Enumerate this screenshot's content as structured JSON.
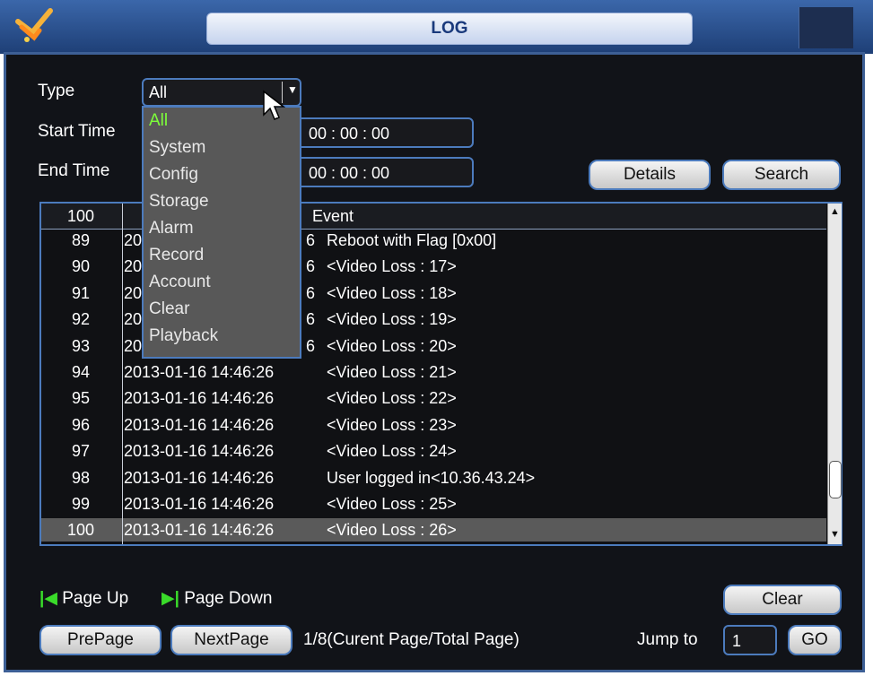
{
  "window": {
    "title": "LOG"
  },
  "filters": {
    "type_label": "Type",
    "type_value": "All",
    "start_label": "Start Time",
    "start_time": "00 :  00 :  00",
    "end_label": "End Time",
    "end_time": "00 :  00 :  00"
  },
  "buttons": {
    "details": "Details",
    "search": "Search",
    "clear": "Clear",
    "prev": "PrePage",
    "next": "NextPage",
    "go": "GO"
  },
  "dropdown_options": [
    "All",
    "System",
    "Config",
    "Storage",
    "Alarm",
    "Record",
    "Account",
    "Clear",
    "Playback"
  ],
  "table": {
    "headers": {
      "no": "100",
      "event": "Event"
    },
    "rows": [
      {
        "no": "89",
        "time": "20",
        "time_tail": "6",
        "event": "Reboot with Flag [0x00]"
      },
      {
        "no": "90",
        "time": "20",
        "time_tail": "6",
        "event": "<Video Loss : 17>"
      },
      {
        "no": "91",
        "time": "20",
        "time_tail": "6",
        "event": "<Video Loss : 18>"
      },
      {
        "no": "92",
        "time": "20",
        "time_tail": "6",
        "event": "<Video Loss : 19>"
      },
      {
        "no": "93",
        "time": "20",
        "time_tail": "6",
        "event": "<Video Loss : 20>"
      },
      {
        "no": "94",
        "time": "2013-01-16 14:46:26",
        "event": "<Video Loss : 21>"
      },
      {
        "no": "95",
        "time": "2013-01-16 14:46:26",
        "event": "<Video Loss : 22>"
      },
      {
        "no": "96",
        "time": "2013-01-16 14:46:26",
        "event": "<Video Loss : 23>"
      },
      {
        "no": "97",
        "time": "2013-01-16 14:46:26",
        "event": "<Video Loss : 24>"
      },
      {
        "no": "98",
        "time": "2013-01-16 14:46:26",
        "event": "User logged in<10.36.43.24>"
      },
      {
        "no": "99",
        "time": "2013-01-16 14:46:26",
        "event": "<Video Loss : 25>"
      },
      {
        "no": "100",
        "time": "2013-01-16 14:46:26",
        "event": "<Video Loss : 26>"
      }
    ]
  },
  "paging": {
    "page_up": "Page Up",
    "page_down": "Page Down",
    "status": "1/8(Curent Page/Total Page)",
    "jump_label": "Jump to",
    "jump_value": "1"
  },
  "colors": {
    "accent": "#4c7bbd",
    "active_option": "#7dff3a",
    "page_icon": "#3adc2a"
  }
}
